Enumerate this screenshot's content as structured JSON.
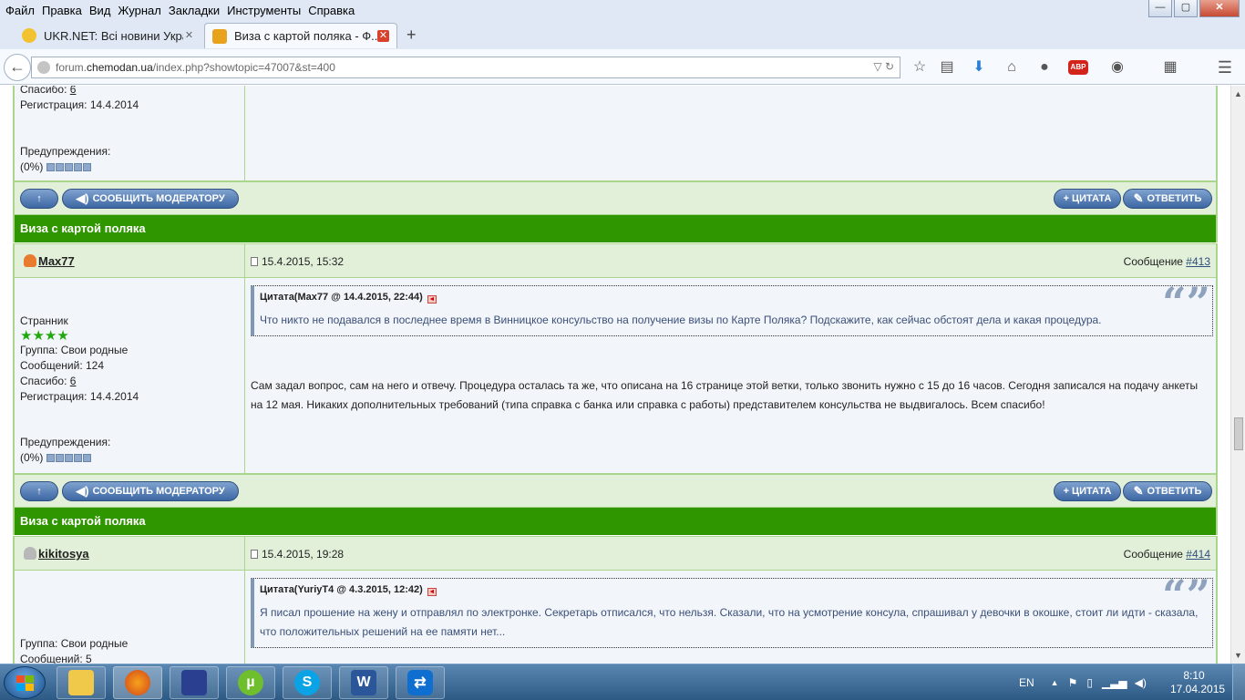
{
  "menu": [
    "Файл",
    "Правка",
    "Вид",
    "Журнал",
    "Закладки",
    "Инструменты",
    "Справка"
  ],
  "window_controls": {
    "minimize": "—",
    "maximize": "▢",
    "close": "✕"
  },
  "tabs": [
    {
      "title": "UKR.NET: Всі новини Укра...",
      "close": "✕",
      "favicon_color": "#f2c230"
    },
    {
      "title": "Виза с картой поляка - Ф...",
      "close": "✕",
      "favicon_color": "#e8a21c"
    }
  ],
  "new_tab": "+",
  "address": {
    "prefix": "forum.",
    "host": "chemodan.ua",
    "path": "/index.php?showtopic=47007&st=400"
  },
  "toolbar_icons": [
    "back-icon",
    "bookmark-star-icon",
    "reading-list-icon",
    "download-icon",
    "home-icon",
    "chat-icon",
    "adblock-icon",
    "extension-icon",
    "addon-icon",
    "menu-icon"
  ],
  "adblock_label": "ABP",
  "post_prev": {
    "thanks_label": "Спасибо: ",
    "thanks_value": "6",
    "registration": "Регистрация: 14.4.2014",
    "warnings_label": "Предупреждения:",
    "warnings_value": "(0%)"
  },
  "buttons": {
    "top": "↑",
    "report": "СООБЩИТЬ МОДЕРАТОРУ",
    "quote": "+ ЦИТАТА",
    "reply": "ОТВЕТИТЬ"
  },
  "topic_title": "Виза с картой поляка",
  "posts": [
    {
      "author": "Max77",
      "date": "15.4.2015, 15:32",
      "num_label": "Сообщение ",
      "num": "#413",
      "rank": "Странник",
      "stars": "★★★★",
      "group": "Группа: Свои родные",
      "messages": "Сообщений: 124",
      "thanks_label": "Спасибо: ",
      "thanks_value": "6",
      "registration": "Регистрация: 14.4.2014",
      "warnings_label": "Предупреждения:",
      "warnings_value": "(0%)",
      "quote_header": "Цитата(Max77 @ 14.4.2015, 22:44)",
      "quote_text": "Что никто не подавался в последнее время в Винницкое консульство на получение визы по Карте Поляка? Подскажите, как сейчас обстоят дела и какая процедура.",
      "text": "Сам задал вопрос, сам на него и отвечу. Процедура осталась та же, что описана на 16 странице этой ветки, только звонить нужно с 15 до 16 часов. Сегодня записался на подачу анкеты на 12 мая. Никаких дополнительных требований (типа справка с банка или справка с работы) представителем консульства не выдвигалось. Всем спасибо!"
    },
    {
      "author": "kikitosya",
      "date": "15.4.2015, 19:28",
      "num_label": "Сообщение ",
      "num": "#414",
      "group": "Группа: Свои родные",
      "messages": "Сообщений: 5",
      "quote_header": "Цитата(YuriyT4 @ 4.3.2015, 12:42)",
      "quote_text": "Я писал прошение на жену и отправлял по электронке. Секретарь отписался, что нельзя. Сказали, что на усмотрение консула, спрашивал у девочки в окошке, стоит ли идти - сказала, что положительных решений на ее памяти нет..."
    }
  ],
  "taskbar": {
    "apps": [
      "explorer",
      "firefox",
      "save",
      "utorrent",
      "skype",
      "word",
      "teamviewer"
    ],
    "app_letters": {
      "utorrent": "µ",
      "skype": "S",
      "word": "W"
    },
    "lang": "EN",
    "time": "8:10",
    "date": "17.04.2015"
  }
}
